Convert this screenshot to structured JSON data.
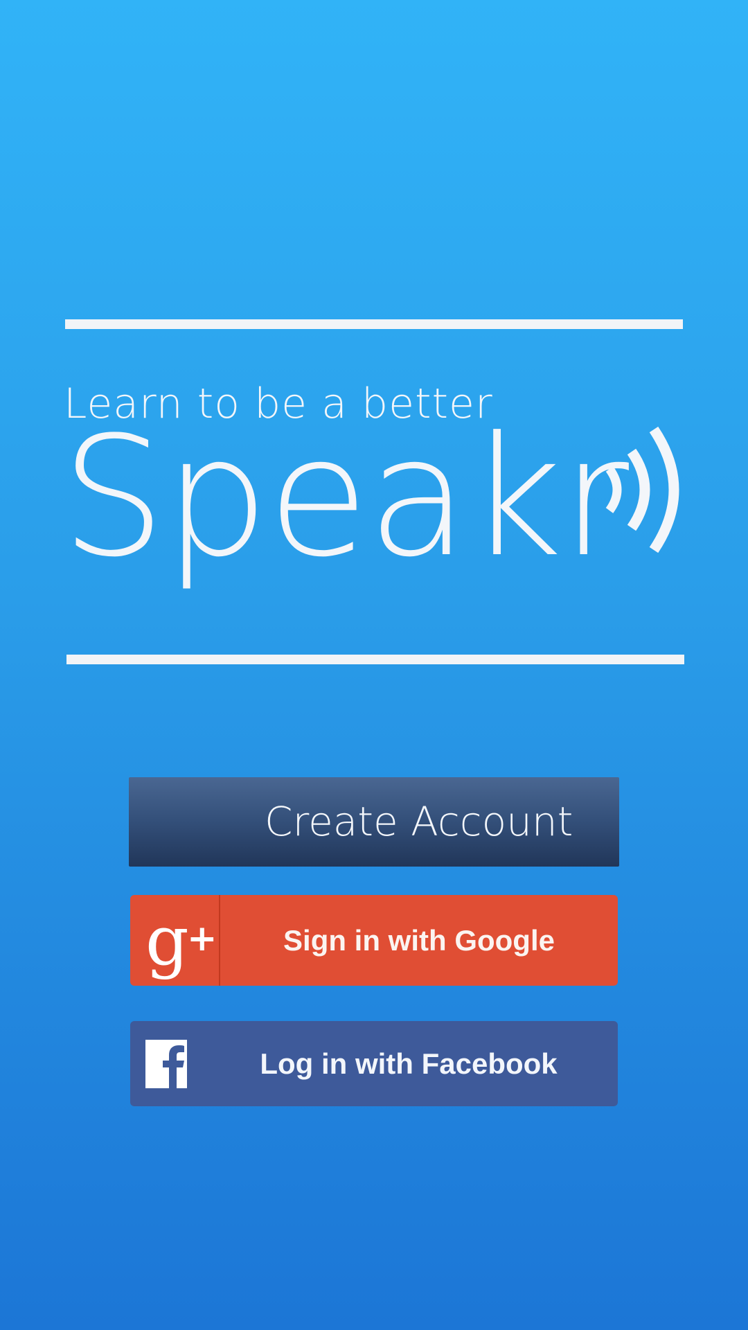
{
  "hero": {
    "tagline": "Learn to be a better",
    "logo_text": "Speakr",
    "logo_icon": "sound-waves-icon"
  },
  "actions": {
    "create_account_label": "Create Account",
    "google_label": "Sign in with Google",
    "google_icon": "google-plus-icon",
    "facebook_label": "Log in with Facebook",
    "facebook_icon": "facebook-icon"
  },
  "colors": {
    "background_top": "#31b3f7",
    "background_bottom": "#1c76d6",
    "create_account": "#334f79",
    "google": "#e04e34",
    "facebook": "#3e5a9a",
    "text": "#f3f6fa"
  }
}
